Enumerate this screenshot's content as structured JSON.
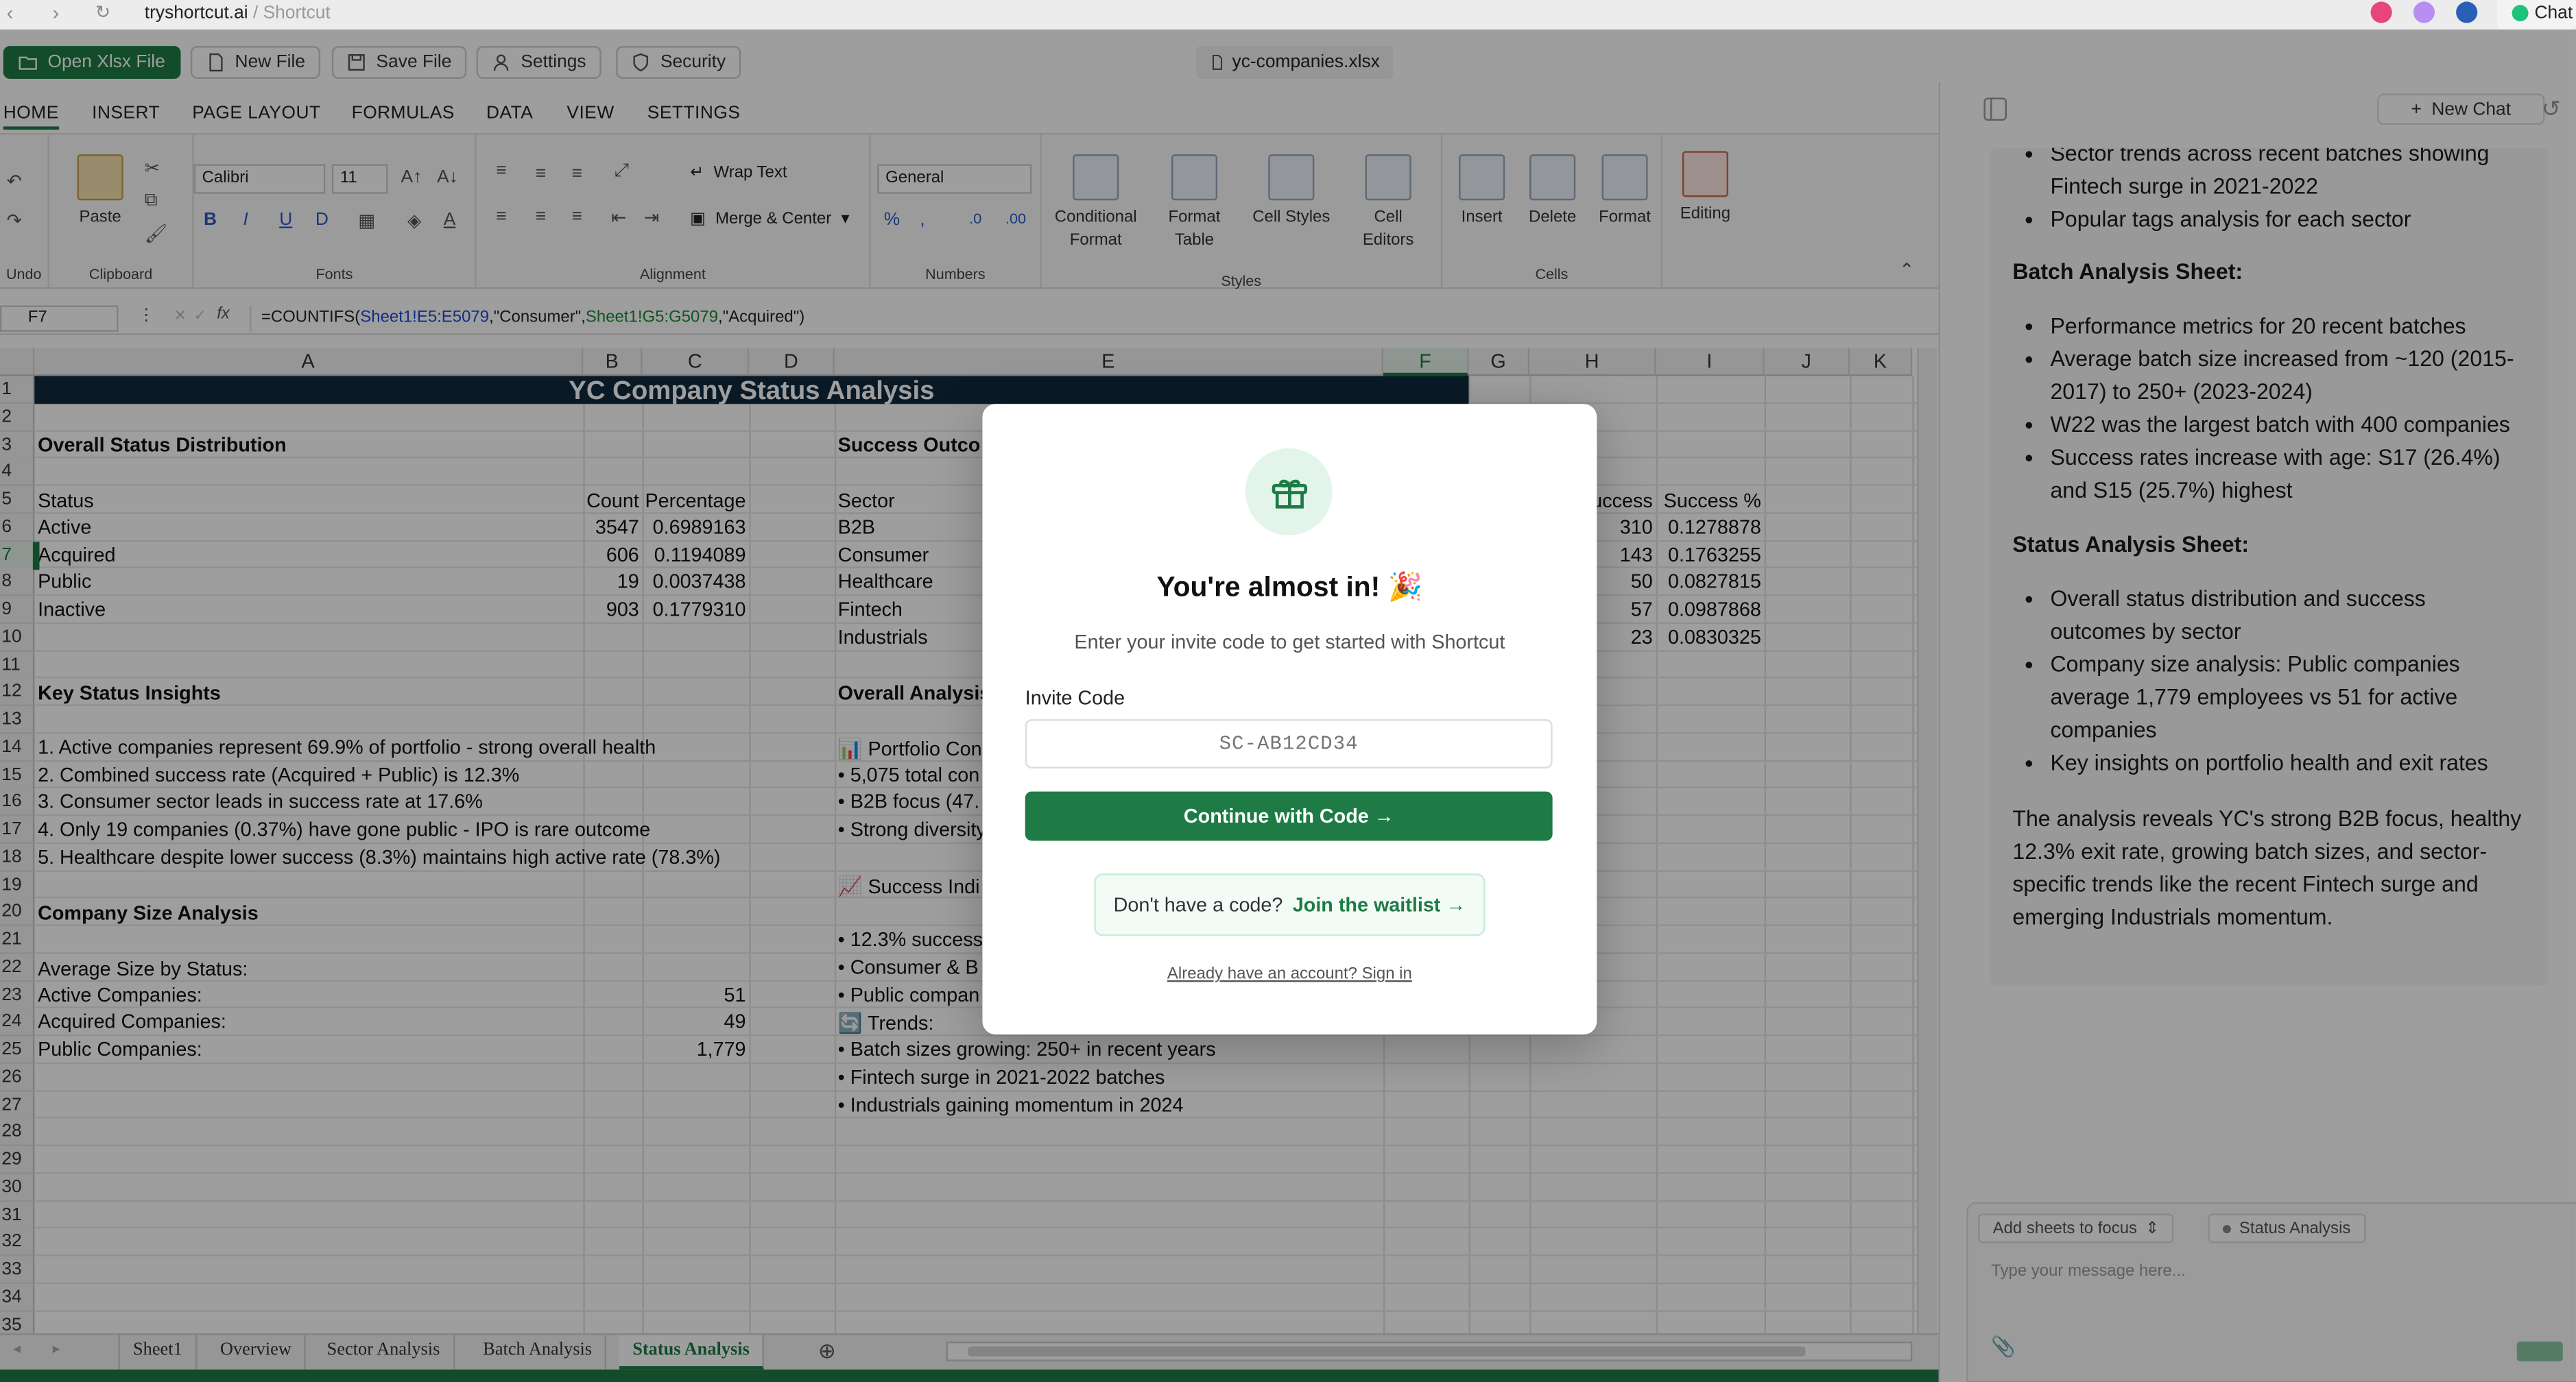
{
  "browser": {
    "domain": "tryshortcut.ai",
    "path": " / Shortcut",
    "chat_label": "Chat"
  },
  "toolbar": {
    "open": "Open Xlsx File",
    "new": "New File",
    "save": "Save File",
    "settings": "Settings",
    "security": "Security",
    "filename": "yc-companies.xlsx"
  },
  "ribbon_tabs": [
    "HOME",
    "INSERT",
    "PAGE LAYOUT",
    "FORMULAS",
    "DATA",
    "VIEW",
    "SETTINGS"
  ],
  "ribbon": {
    "undo": "Undo",
    "paste": "Paste",
    "clipboard": "Clipboard",
    "font_name": "Calibri",
    "font_size": "11",
    "fonts": "Fonts",
    "wrap": "Wrap Text",
    "merge": "Merge & Center",
    "alignment": "Alignment",
    "number_format": "General",
    "numbers": "Numbers",
    "cond_format": "Conditional Format",
    "format_table": "Format Table",
    "cell_styles": "Cell Styles",
    "cell_editors": "Cell Editors",
    "styles": "Styles",
    "insert": "Insert",
    "delete": "Delete",
    "format": "Format",
    "cells": "Cells",
    "editing": "Editing"
  },
  "formula": {
    "cell_ref": "F7",
    "pre": "=COUNTIFS(",
    "r1": "Sheet1!E5:E5079",
    "mid": ",\"Consumer\",",
    "r2": "Sheet1!G5:G5079",
    "post": ",\"Acquired\")"
  },
  "columns": [
    "A",
    "B",
    "C",
    "D",
    "E",
    "F",
    "G",
    "H",
    "I",
    "J",
    "K"
  ],
  "rows": [
    "1",
    "2",
    "3",
    "4",
    "5",
    "6",
    "7",
    "8",
    "9",
    "10",
    "11",
    "12",
    "13",
    "14",
    "15",
    "16",
    "17",
    "18",
    "19",
    "20",
    "21",
    "22",
    "23",
    "24",
    "25",
    "26",
    "27",
    "28",
    "29",
    "30",
    "31",
    "32",
    "33",
    "34",
    "35"
  ],
  "sheet": {
    "title": "YC Company Status Analysis",
    "overall_header": "Overall Status Distribution",
    "hdr_status": "Status",
    "hdr_count": "Count",
    "hdr_pct": "Percentage",
    "status_rows": [
      {
        "status": "Active",
        "count": "3547",
        "pct": "0.6989163"
      },
      {
        "status": "Acquired",
        "count": "606",
        "pct": "0.1194089"
      },
      {
        "status": "Public",
        "count": "19",
        "pct": "0.0037438"
      },
      {
        "status": "Inactive",
        "count": "903",
        "pct": "0.1779310"
      }
    ],
    "success_header": "Success Outco",
    "hdr_sector": "Sector",
    "hdr_success": "uccess",
    "hdr_success_pct": "Success %",
    "sector_rows": [
      {
        "sector": "B2B",
        "success": "310",
        "pct": "0.1278878"
      },
      {
        "sector": "Consumer",
        "success": "143",
        "pct": "0.1763255"
      },
      {
        "sector": "Healthcare",
        "success": "50",
        "pct": "0.0827815"
      },
      {
        "sector": "Fintech",
        "success": "57",
        "pct": "0.0987868"
      },
      {
        "sector": "Industrials",
        "success": "23",
        "pct": "0.0830325"
      }
    ],
    "insights_header": "Key Status Insights",
    "insights": [
      "1. Active companies represent 69.9% of portfolio - strong overall health",
      "2. Combined success rate (Acquired + Public) is 12.3%",
      "3. Consumer sector leads in success rate at 17.6%",
      "4. Only 19 companies (0.37%) have gone public - IPO is rare outcome",
      "5. Healthcare despite lower success (8.3%) maintains high active rate (78.3%)"
    ],
    "overall_analysis": "Overall Analysis",
    "portfolio_label": "Portfolio Con",
    "portfolio_items": [
      "• 5,075 total con",
      "• B2B focus (47.",
      "• Strong diversity"
    ],
    "success_ind": "Success Indi",
    "success_items": [
      "• 12.3% success",
      "• Consumer & B",
      "• Public compan"
    ],
    "trends": "Trends:",
    "trend_items": [
      "• Batch sizes growing: 250+ in recent years",
      "• Fintech surge in 2021-2022 batches",
      "• Industrials gaining momentum in 2024"
    ],
    "size_header": "Company Size Analysis",
    "avg_label": "Average Size by Status:",
    "size_rows": [
      {
        "label": "Active Companies:",
        "value": "51"
      },
      {
        "label": "Acquired Companies:",
        "value": "49"
      },
      {
        "label": "Public Companies:",
        "value": "1,779"
      }
    ]
  },
  "sheet_tabs": [
    "Sheet1",
    "Overview",
    "Sector Analysis",
    "Batch Analysis",
    "Status Analysis"
  ],
  "modal": {
    "title": "You're almost in! 🎉",
    "subtitle": "Enter your invite code to get started with Shortcut",
    "label": "Invite Code",
    "placeholder": "SC-AB12CD34",
    "continue": "Continue with Code →",
    "no_code": "Don't have a code?",
    "waitlist": "Join the waitlist →",
    "signin": "Already have an account? Sign in"
  },
  "chat": {
    "new_chat": "New Chat",
    "top_bullets": [
      "Sector trends across recent batches showing Fintech surge in 2021-2022",
      "Popular tags analysis for each sector"
    ],
    "batch_header": "Batch Analysis Sheet",
    "batch_bullets": [
      "Performance metrics for 20 recent batches",
      "Average batch size increased from ~120 (2015-2017) to 250+ (2023-2024)",
      "W22 was the largest batch with 400 companies",
      "Success rates increase with age: S17 (26.4%) and S15 (25.7%) highest"
    ],
    "status_header": "Status Analysis Sheet",
    "status_bullets": [
      "Overall status distribution and success outcomes by sector",
      "Company size analysis: Public companies average 1,779 employees vs 51 for active companies",
      "Key insights on portfolio health and exit rates"
    ],
    "summary": "The analysis reveals YC's strong B2B focus, healthy 12.3% exit rate, growing batch sizes, and sector-specific trends like the recent Fintech surge and emerging Industrials momentum.",
    "add_sheets": "Add sheets to focus",
    "focus_sheet": "Status Analysis",
    "input_placeholder": "Type your message here..."
  }
}
